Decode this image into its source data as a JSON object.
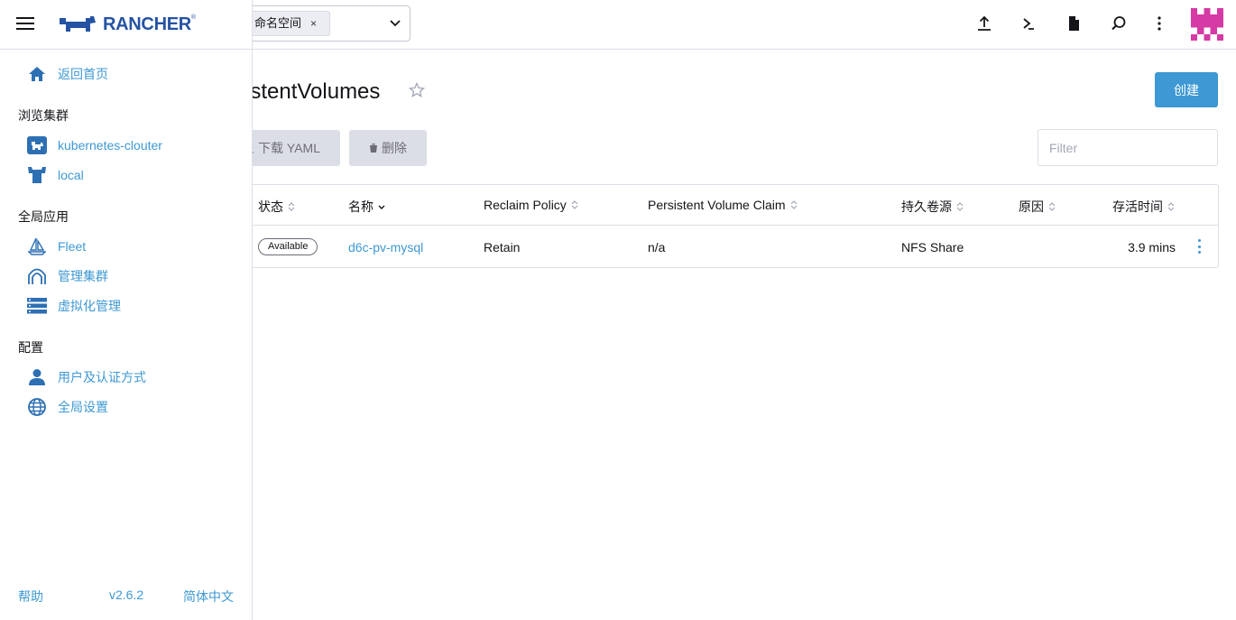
{
  "header": {
    "namespace_chip": "命名空间",
    "namespace_chip_remove": "×"
  },
  "main": {
    "title": "rsistentVolumes",
    "create_label": "创建",
    "bulk_actions": {
      "download_yaml": "下载 YAML",
      "delete": "删除"
    },
    "filter_placeholder": "Filter",
    "table": {
      "columns": [
        "状态",
        "名称",
        "Reclaim Policy",
        "Persistent Volume Claim",
        "持久卷源",
        "原因",
        "存活时间"
      ],
      "rows": [
        {
          "status": "Available",
          "name": "d6c-pv-mysql",
          "reclaim_policy": "Retain",
          "claim": "n/a",
          "source": "NFS Share",
          "reason": "",
          "age": "3.9 mins"
        }
      ]
    }
  },
  "drawer": {
    "logo_text": "RANCHER",
    "logo_mark": "®",
    "home": "返回首页",
    "sections": {
      "clusters": "浏览集群",
      "global_apps": "全局应用",
      "config": "配置"
    },
    "clusters": [
      "kubernetes-clouter",
      "local"
    ],
    "global_apps": [
      "Fleet",
      "管理集群",
      "虚拟化管理"
    ],
    "config": [
      "用户及认证方式",
      "全局设置"
    ],
    "footer": {
      "help": "帮助",
      "version": "v2.6.2",
      "language": "简体中文"
    }
  },
  "colors": {
    "accent": "#3d98d3",
    "brand": "#2453a3",
    "avatar": "#d63aa5"
  },
  "icons": [
    "hamburger-icon",
    "rancher-logo-icon",
    "chevron-down-icon",
    "upload-icon",
    "terminal-icon",
    "file-icon",
    "search-icon",
    "kebab-icon",
    "avatar-icon",
    "star-icon",
    "download-icon",
    "trash-icon",
    "sort-icon",
    "home-icon",
    "cluster-icon",
    "cow-icon",
    "fleet-icon",
    "manager-icon",
    "harvester-icon",
    "user-icon",
    "globe-icon"
  ]
}
